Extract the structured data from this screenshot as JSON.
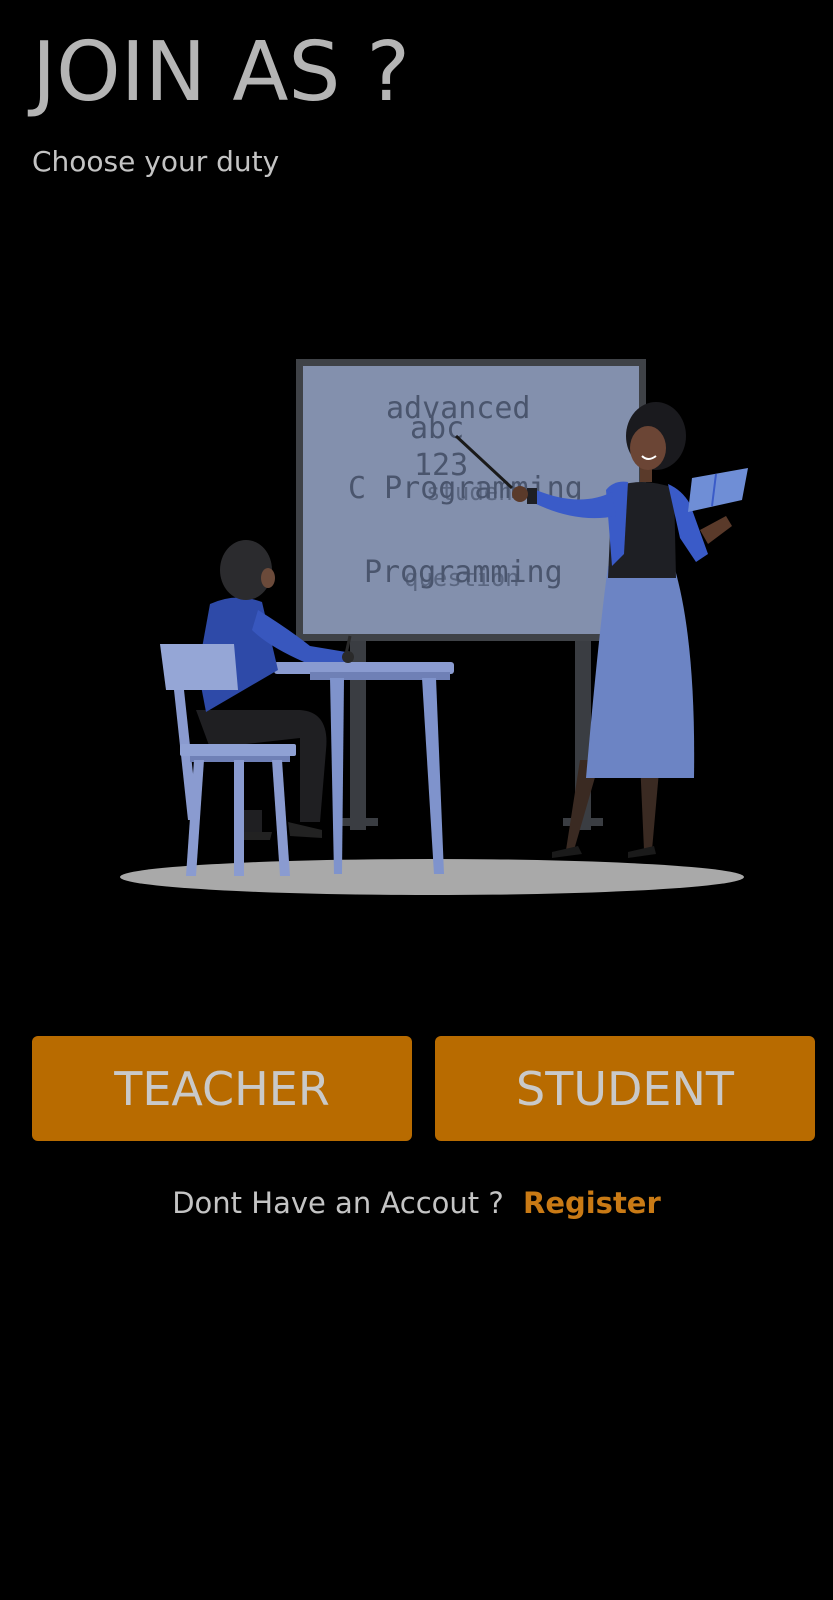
{
  "header": {
    "title": "JOIN AS ?",
    "subtitle": "Choose your duty"
  },
  "illustration": {
    "name": "teacher-student-classroom-illustration",
    "board_lines": [
      "advanced",
      "abc",
      "123",
      "C Programming",
      "Programming",
      "student",
      "question"
    ]
  },
  "buttons": {
    "teacher_label": "TEACHER",
    "student_label": "STUDENT"
  },
  "register": {
    "prompt": "Dont Have an Accout ?",
    "link_label": "Register"
  },
  "colors": {
    "background": "#000000",
    "button": "#b86b00",
    "accent_link": "#c97a15",
    "text": "#b5b5b5"
  }
}
